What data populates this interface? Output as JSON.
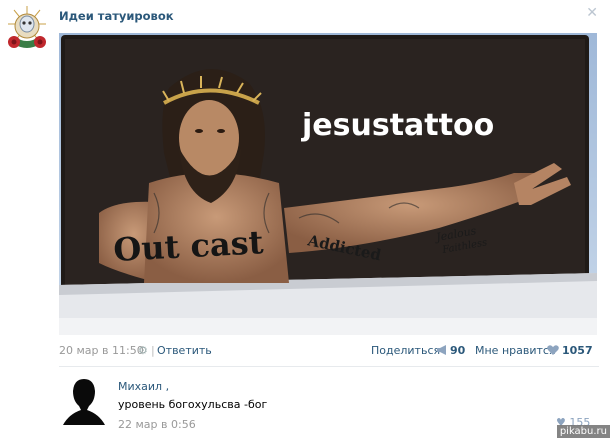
{
  "post": {
    "group_name": "Идеи татуировок",
    "image": {
      "headline": "jesustattoo",
      "chest_text": "Out cast",
      "arm_text_1": "Addicted",
      "arm_text_2": "Jealous",
      "arm_text_3": "Faithless"
    },
    "date": "20 мар в 11:50",
    "reply_label": "Ответить",
    "share_label": "Поделиться",
    "share_count": "90",
    "like_label": "Мне нравится",
    "like_count": "1057"
  },
  "comment": {
    "author": "Михаил ,",
    "text": "уровень богохульсва -бог",
    "date": "22 мар в 0:56",
    "likes": "155"
  },
  "watermark": "pikabu.ru",
  "colors": {
    "link": "#2b587a",
    "muted": "#999999"
  }
}
